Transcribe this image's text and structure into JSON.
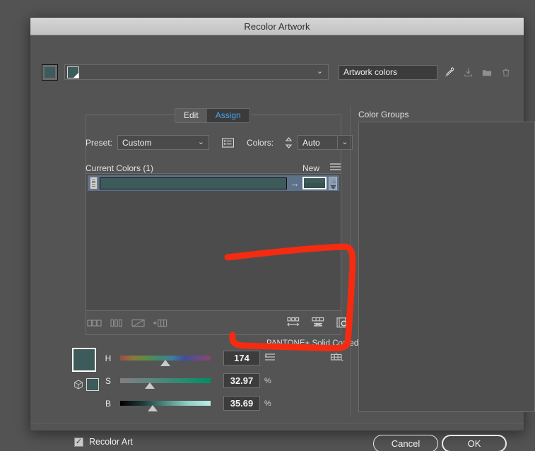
{
  "window": {
    "title": "Recolor Artwork"
  },
  "toolbar": {
    "active_color_swatch_label": "active-color",
    "color_combo_label": "color-source-combo",
    "group_name_value": "Artwork colors",
    "icons": [
      {
        "name": "eyedropper-icon",
        "glyph": "✐"
      },
      {
        "name": "save-color-group-icon",
        "glyph": "⤓"
      },
      {
        "name": "new-color-group-folder-icon",
        "glyph": "▰"
      },
      {
        "name": "delete-color-group-icon",
        "glyph": "🗑"
      }
    ]
  },
  "tabs": [
    {
      "label": "Edit",
      "active": false
    },
    {
      "label": "Assign",
      "active": true
    }
  ],
  "controls": {
    "preset_label": "Preset:",
    "preset_value": "Custom",
    "colors_label": "Colors:",
    "colors_value": "Auto",
    "color_reduction_options_icon": "color-reduction-options-icon",
    "stepper_icon": "stepper-icon"
  },
  "current_colors": {
    "title": "Current Colors (1)",
    "new_label": "New",
    "menu_icon": "hamburger-menu-icon",
    "rows": [
      {
        "selected": true,
        "grip_icon": "drag-grip-icon",
        "current_color": "#3D5B5A",
        "arrow_glyph": "→",
        "new_color_top": "#3D5B5A",
        "new_color_bottom": "#37524F",
        "dropdown_icon": "chevron-down-icon"
      }
    ],
    "scroll_up_icon": "scroll-up-arrow-icon"
  },
  "list_tools_left": [
    {
      "name": "separate-colors-icon"
    },
    {
      "name": "merge-colors-icon"
    },
    {
      "name": "exclude-color-icon"
    },
    {
      "name": "add-color-row-icon"
    }
  ],
  "list_tools_right": [
    {
      "name": "randomly-change-color-order-icon"
    },
    {
      "name": "randomly-change-saturation-brightness-icon"
    },
    {
      "name": "preview-color-group-icon"
    }
  ],
  "color_library": {
    "name": "PANTONE+ Solid Coated",
    "menu_icon": "library-menu-icon",
    "grid_icon": "color-library-grid-icon"
  },
  "color_model": {
    "preview_color": "#3D5B5A",
    "proof_swatch_color": "#3D5B5A",
    "cube_icon": "color-model-cube-icon",
    "sliders": [
      {
        "channel": "H",
        "value": "174",
        "unit": "°",
        "position_pct": 50
      },
      {
        "channel": "S",
        "value": "32.97",
        "unit": "%",
        "position_pct": 33
      },
      {
        "channel": "B",
        "value": "35.69",
        "unit": "%",
        "position_pct": 36
      }
    ]
  },
  "color_groups": {
    "label": "Color Groups",
    "items": [],
    "collapse_icon": "collapse-panel-arrow-icon"
  },
  "footer": {
    "recolor_art_label": "Recolor Art",
    "recolor_art_checked": true,
    "check_glyph": "✓",
    "cancel_label": "Cancel",
    "ok_label": "OK"
  },
  "annotation": {
    "name": "red-highlight-loop",
    "color": "#F42B10"
  }
}
